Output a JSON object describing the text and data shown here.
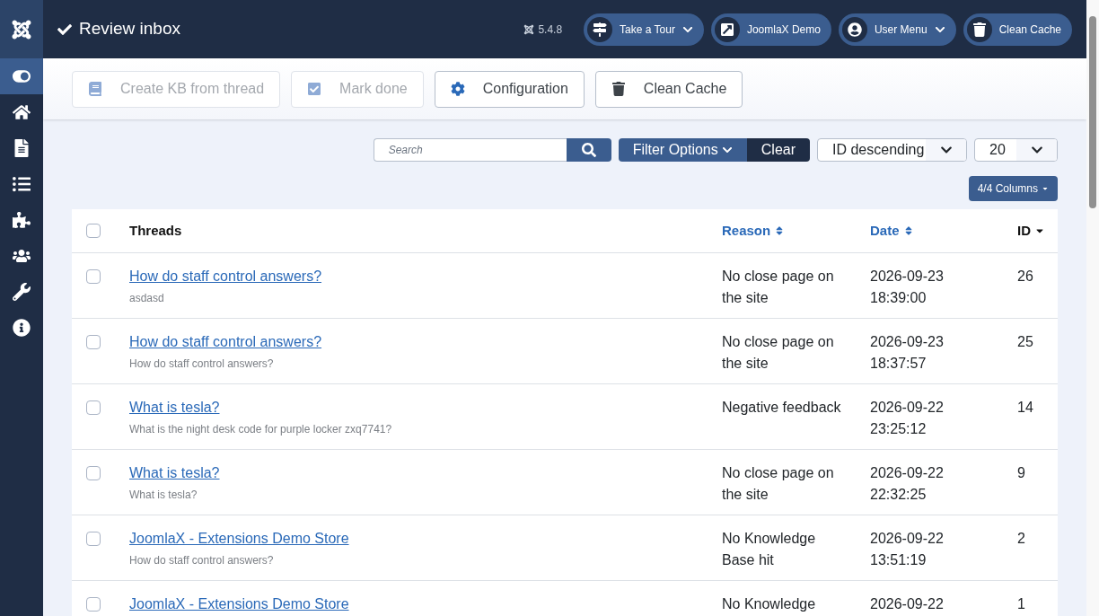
{
  "header": {
    "title": "Review inbox",
    "version": "5.4.8",
    "actions": [
      {
        "label": "Take a Tour",
        "dropdown": true
      },
      {
        "label": "JoomlaX Demo",
        "dropdown": false
      },
      {
        "label": "User Menu",
        "dropdown": true
      },
      {
        "label": "Clean Cache",
        "dropdown": false
      }
    ]
  },
  "sidebar": {
    "items": [
      {
        "selected": true
      },
      {
        "selected": false
      },
      {
        "selected": false
      },
      {
        "selected": false
      },
      {
        "selected": false
      },
      {
        "selected": false
      },
      {
        "selected": false
      },
      {
        "selected": false
      }
    ]
  },
  "toolbar": [
    {
      "label": "Create KB from thread",
      "disabled": true
    },
    {
      "label": "Mark done",
      "disabled": true
    },
    {
      "label": "Configuration",
      "disabled": false
    },
    {
      "label": "Clean Cache",
      "disabled": false
    }
  ],
  "filters": {
    "search_placeholder": "Search",
    "filter_options": "Filter Options",
    "clear": "Clear",
    "ordering": "ID descending",
    "limit": "20",
    "columns": "4/4 Columns"
  },
  "table": {
    "select_all_checked": false,
    "columns": [
      {
        "label": "Threads",
        "kind": "plain"
      },
      {
        "label": "Reason",
        "kind": "sortable"
      },
      {
        "label": "Date",
        "kind": "sortable"
      },
      {
        "label": "ID",
        "kind": "sorted"
      }
    ],
    "rows": [
      {
        "title": "How do staff control answers?",
        "subtitle": "asdasd",
        "reason": "No close page on the site",
        "date": "2026-09-23",
        "time": "18:39:00",
        "id": "26",
        "checked": false
      },
      {
        "title": "How do staff control answers?",
        "subtitle": "How do staff control answers?",
        "reason": "No close page on the site",
        "date": "2026-09-23",
        "time": "18:37:57",
        "id": "25",
        "checked": false
      },
      {
        "title": "What is tesla?",
        "subtitle": "What is the night desk code for purple locker zxq7741?",
        "reason": "Negative feedback",
        "date": "2026-09-22",
        "time": "23:25:12",
        "id": "14",
        "checked": false
      },
      {
        "title": "What is tesla?",
        "subtitle": "What is tesla?",
        "reason": "No close page on the site",
        "date": "2026-09-22",
        "time": "22:32:25",
        "id": "9",
        "checked": false
      },
      {
        "title": "JoomlaX - Extensions Demo Store",
        "subtitle": "How do staff control answers?",
        "reason": "No Knowledge Base hit",
        "date": "2026-09-22",
        "time": "13:51:19",
        "id": "2",
        "checked": false
      },
      {
        "title": "JoomlaX - Extensions Demo Store",
        "reason": "No Knowledge",
        "date": "2026-09-22",
        "id": "1",
        "checked": false
      }
    ]
  }
}
